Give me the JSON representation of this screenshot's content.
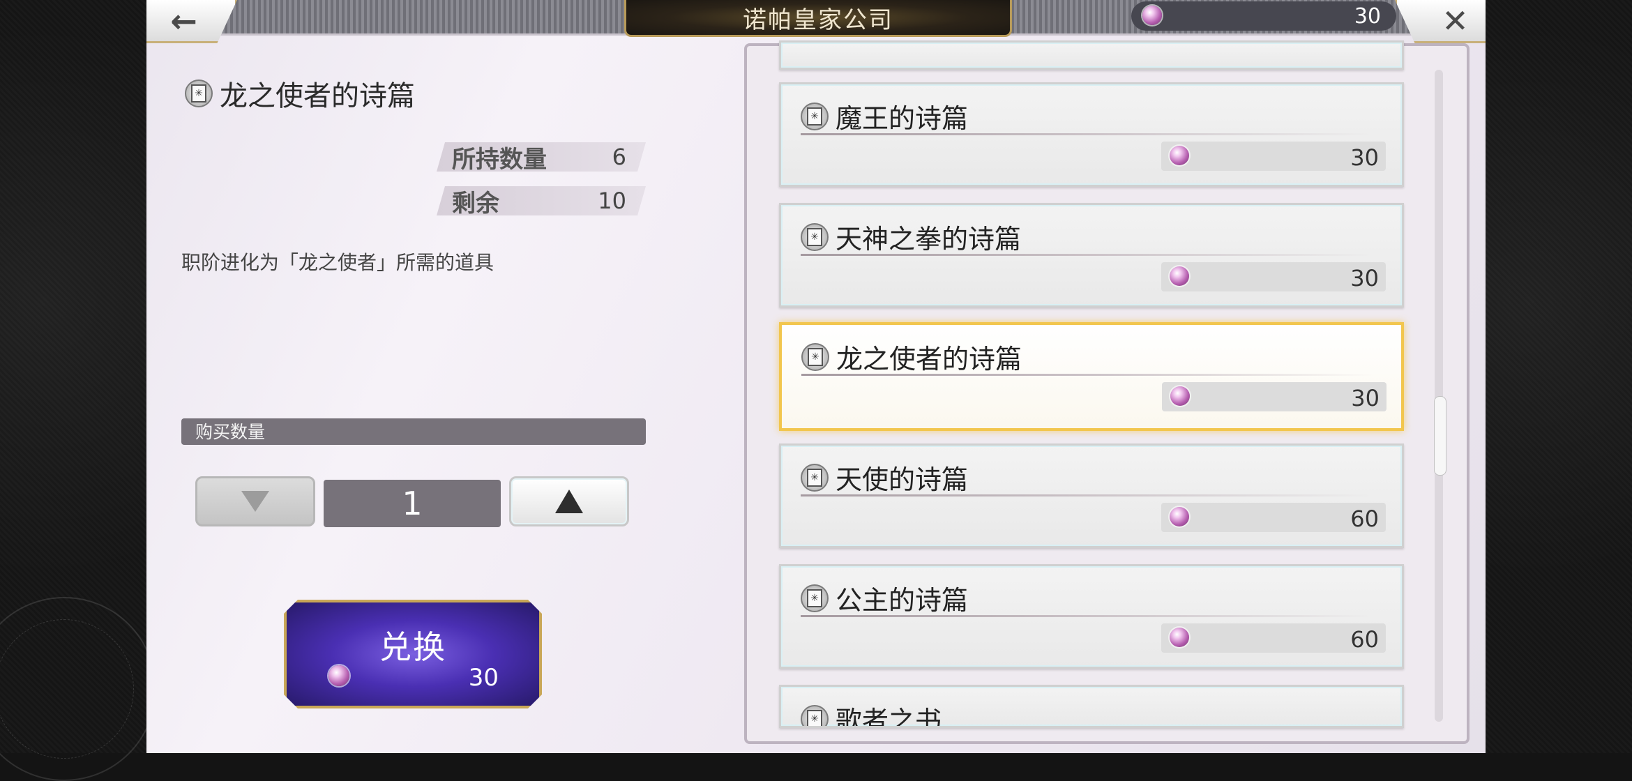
{
  "header": {
    "title": "诺帕皇家公司",
    "currency_value": "30"
  },
  "icons": {
    "back": "←",
    "close": "✕",
    "item_book": "✳"
  },
  "detail": {
    "item_name": "龙之使者的诗篇",
    "stats": [
      {
        "label": "所持数量",
        "value": "6"
      },
      {
        "label": "剩余",
        "value": "10"
      }
    ],
    "description": "职阶进化为「龙之使者」所需的道具",
    "quantity_label": "购买数量",
    "quantity_value": "1",
    "exchange_label": "兑换",
    "exchange_cost": "30"
  },
  "items": [
    {
      "name": "魔王的诗篇",
      "price": "30"
    },
    {
      "name": "天神之拳的诗篇",
      "price": "30"
    },
    {
      "name": "龙之使者的诗篇",
      "price": "30",
      "selected": true
    },
    {
      "name": "天使的诗篇",
      "price": "60"
    },
    {
      "name": "公主的诗篇",
      "price": "60"
    },
    {
      "name": "歌者之书"
    }
  ],
  "colors": {
    "gold_accent": "#c9a757",
    "selected_border": "#f2c64e",
    "exchange_purple": "#4a2fb3"
  }
}
